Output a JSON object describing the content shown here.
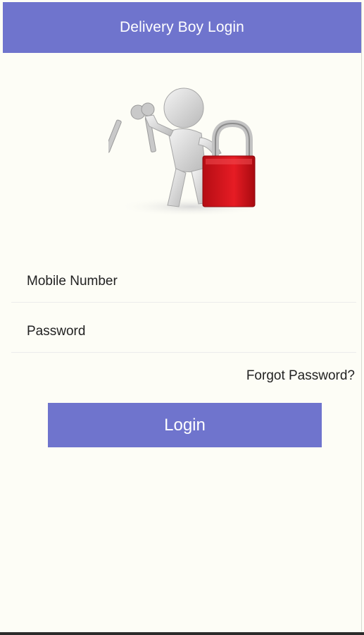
{
  "header": {
    "title": "Delivery Boy Login"
  },
  "illustration": {
    "icon": "person-with-keys-and-padlock-icon",
    "lock_color": "#d8121b"
  },
  "form": {
    "mobile_placeholder": "Mobile Number",
    "password_placeholder": "Password",
    "forgot_label": "Forgot Password?",
    "login_label": "Login"
  },
  "colors": {
    "accent": "#6f74cd",
    "background": "#fdfdf6"
  }
}
